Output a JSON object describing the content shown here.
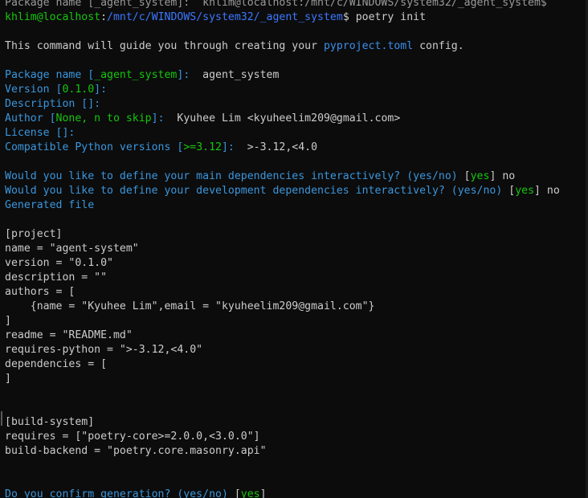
{
  "terminal": {
    "lines": [
      {
        "segments": [
          {
            "t": "Package name [_agent_system]:  khlim@localhost:/mnt/c/WINDOWS/system32/_agent_system$",
            "c": "grey"
          }
        ]
      },
      {
        "segments": [
          {
            "t": "khlim@localhost",
            "c": "green"
          },
          {
            "t": ":",
            "c": "default"
          },
          {
            "t": "/mnt/c/WINDOWS/system32/_agent_system",
            "c": "blue"
          },
          {
            "t": "$ poetry init",
            "c": "default"
          }
        ]
      },
      {
        "segments": []
      },
      {
        "segments": [
          {
            "t": "This command will guide you through creating your ",
            "c": "default"
          },
          {
            "t": "pyproject.toml",
            "c": "lblue"
          },
          {
            "t": " config.",
            "c": "default"
          }
        ]
      },
      {
        "segments": []
      },
      {
        "segments": [
          {
            "t": "Package name [",
            "c": "cyan"
          },
          {
            "t": "_agent_system",
            "c": "green"
          },
          {
            "t": "]:",
            "c": "cyan"
          },
          {
            "t": "  agent_system",
            "c": "default"
          }
        ]
      },
      {
        "segments": [
          {
            "t": "Version [",
            "c": "cyan"
          },
          {
            "t": "0.1.0",
            "c": "green"
          },
          {
            "t": "]:",
            "c": "cyan"
          }
        ]
      },
      {
        "segments": [
          {
            "t": "Description []:",
            "c": "cyan"
          }
        ]
      },
      {
        "segments": [
          {
            "t": "Author [",
            "c": "cyan"
          },
          {
            "t": "None, n to skip",
            "c": "green"
          },
          {
            "t": "]:",
            "c": "cyan"
          },
          {
            "t": "  Kyuhee Lim <kyuheelim209@gmail.com>",
            "c": "default"
          }
        ]
      },
      {
        "segments": [
          {
            "t": "License []:",
            "c": "cyan"
          }
        ]
      },
      {
        "segments": [
          {
            "t": "Compatible Python versions [",
            "c": "cyan"
          },
          {
            "t": ">=3.12",
            "c": "green"
          },
          {
            "t": "]:",
            "c": "cyan"
          },
          {
            "t": "  >-3.12,<4.0",
            "c": "default"
          }
        ]
      },
      {
        "segments": []
      },
      {
        "segments": [
          {
            "t": "Would you like to define your main dependencies interactively? (yes/no) ",
            "c": "cyan"
          },
          {
            "t": "[",
            "c": "default"
          },
          {
            "t": "yes",
            "c": "green"
          },
          {
            "t": "] no",
            "c": "default"
          }
        ]
      },
      {
        "segments": [
          {
            "t": "Would you like to define your development dependencies interactively? (yes/no) ",
            "c": "cyan"
          },
          {
            "t": "[",
            "c": "default"
          },
          {
            "t": "yes",
            "c": "green"
          },
          {
            "t": "] no",
            "c": "default"
          }
        ]
      },
      {
        "segments": [
          {
            "t": "Generated file",
            "c": "cyan"
          }
        ]
      },
      {
        "segments": []
      },
      {
        "segments": [
          {
            "t": "[project]",
            "c": "default"
          }
        ]
      },
      {
        "segments": [
          {
            "t": "name = \"agent-system\"",
            "c": "default"
          }
        ]
      },
      {
        "segments": [
          {
            "t": "version = \"0.1.0\"",
            "c": "default"
          }
        ]
      },
      {
        "segments": [
          {
            "t": "description = \"\"",
            "c": "default"
          }
        ]
      },
      {
        "segments": [
          {
            "t": "authors = [",
            "c": "default"
          }
        ]
      },
      {
        "segments": [
          {
            "t": "    {name = \"Kyuhee Lim\",email = \"kyuheelim209@gmail.com\"}",
            "c": "default"
          }
        ]
      },
      {
        "segments": [
          {
            "t": "]",
            "c": "default"
          }
        ]
      },
      {
        "segments": [
          {
            "t": "readme = \"README.md\"",
            "c": "default"
          }
        ]
      },
      {
        "segments": [
          {
            "t": "requires-python = \">-3.12,<4.0\"",
            "c": "default"
          }
        ]
      },
      {
        "segments": [
          {
            "t": "dependencies = [",
            "c": "default"
          }
        ]
      },
      {
        "segments": [
          {
            "t": "]",
            "c": "default"
          }
        ]
      },
      {
        "segments": []
      },
      {
        "segments": []
      },
      {
        "segments": [
          {
            "t": "[build-system]",
            "c": "default"
          }
        ]
      },
      {
        "segments": [
          {
            "t": "requires = [\"poetry-core>=2.0.0,<3.0.0\"]",
            "c": "default"
          }
        ]
      },
      {
        "segments": [
          {
            "t": "build-backend = \"poetry.core.masonry.api\"",
            "c": "default"
          }
        ]
      },
      {
        "segments": []
      },
      {
        "segments": []
      },
      {
        "segments": [
          {
            "t": "Do you confirm generation? (yes/no) ",
            "c": "cyan"
          },
          {
            "t": "[",
            "c": "default"
          },
          {
            "t": "yes",
            "c": "green"
          },
          {
            "t": "]",
            "c": "default"
          }
        ]
      }
    ]
  },
  "colors": {
    "background": "#0c0c0c",
    "text": "#cccccc",
    "prompt_user": "#16c60c",
    "prompt_path": "#3b78ff",
    "question": "#3a96dd",
    "default_value": "#16c60c"
  }
}
